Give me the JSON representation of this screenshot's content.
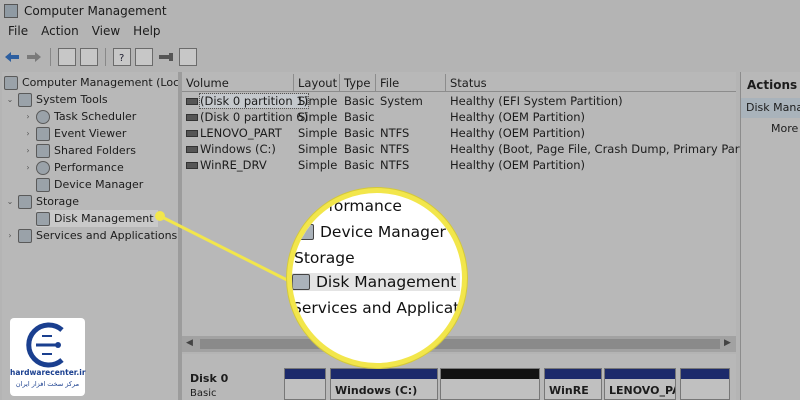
{
  "window": {
    "title": "Computer Management"
  },
  "menu": [
    "File",
    "Action",
    "View",
    "Help"
  ],
  "tree": {
    "root": "Computer Management (Local)",
    "system_tools": "System Tools",
    "task_scheduler": "Task Scheduler",
    "event_viewer": "Event Viewer",
    "shared_folders": "Shared Folders",
    "performance": "Performance",
    "device_manager": "Device Manager",
    "storage": "Storage",
    "disk_management": "Disk Management",
    "services_apps": "Services and Applications"
  },
  "volume_list": {
    "headers": [
      "Volume",
      "Layout",
      "Type",
      "File System",
      "Status"
    ],
    "rows": [
      [
        "(Disk 0 partition 1)",
        "Simple",
        "Basic",
        "",
        "Healthy (EFI System Partition)"
      ],
      [
        "(Disk 0 partition 6)",
        "Simple",
        "Basic",
        "",
        "Healthy (OEM Partition)"
      ],
      [
        "LENOVO_PART",
        "Simple",
        "Basic",
        "NTFS",
        "Healthy (OEM Partition)"
      ],
      [
        "Windows (C:)",
        "Simple",
        "Basic",
        "NTFS",
        "Healthy (Boot, Page File, Crash Dump, Primary Partition)"
      ],
      [
        "WinRE_DRV",
        "Simple",
        "Basic",
        "NTFS",
        "Healthy (OEM Partition)"
      ]
    ]
  },
  "disk_view": {
    "disk_label": "Disk 0",
    "disk_type": "Basic",
    "partitions": [
      "",
      "Windows (C:)",
      "",
      "WinRE",
      "LENOVO_PAI",
      ""
    ]
  },
  "actions": {
    "title": "Actions",
    "section": "Disk Manag",
    "more": "More A"
  },
  "magnifier": {
    "performance_partial": "rformance",
    "device_manager": "Device Manager",
    "storage": "Storage",
    "disk_management": "Disk Management",
    "services_partial": "Services and Applicatio"
  },
  "logo": {
    "site": "hardwarecenter.ir",
    "tagline": "مرکز سخت افزار ایران"
  },
  "colors": {
    "callout": "#f2e64b",
    "partition_bar": "#1c2a6b"
  }
}
